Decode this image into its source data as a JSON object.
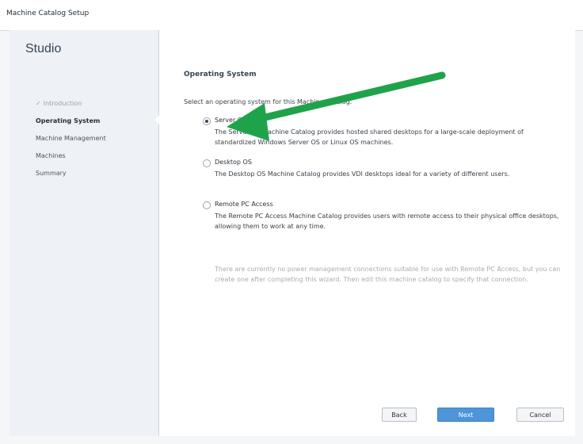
{
  "window": {
    "title": "Machine Catalog Setup"
  },
  "sidebar": {
    "studio_title": "Studio",
    "steps": [
      {
        "label": "Introduction",
        "state": "done"
      },
      {
        "label": "Operating System",
        "state": "current"
      },
      {
        "label": "Machine Management",
        "state": "pending"
      },
      {
        "label": "Machines",
        "state": "pending"
      },
      {
        "label": "Summary",
        "state": "pending"
      }
    ]
  },
  "main": {
    "heading": "Operating System",
    "prompt": "Select an operating system for this Machine Catalog.",
    "options": [
      {
        "label": "Server OS",
        "selected": true,
        "description": "The Server OS Machine Catalog provides hosted shared desktops for a large-scale deployment of standardized Windows Server OS or Linux OS machines."
      },
      {
        "label": "Desktop OS",
        "selected": false,
        "description": "The Desktop OS Machine Catalog provides VDI desktops ideal for a variety of different users."
      },
      {
        "label": "Remote PC Access",
        "selected": false,
        "description": "The Remote PC Access Machine Catalog provides users with remote access to their physical office desktops, allowing them to work at any time."
      }
    ],
    "note": "There are currently no power management connections suitable for use with Remote PC Access, but you can create one after completing this wizard. Then edit this machine catalog to specify that connection."
  },
  "buttons": {
    "back": "Back",
    "next": "Next",
    "cancel": "Cancel"
  },
  "colors": {
    "accent": "#4d95d8",
    "annotation_arrow": "#1fa34a",
    "sidebar_bg": "#eef1f5"
  },
  "icons": {
    "done_step": "check-icon",
    "annotation": "green-arrow-icon"
  }
}
